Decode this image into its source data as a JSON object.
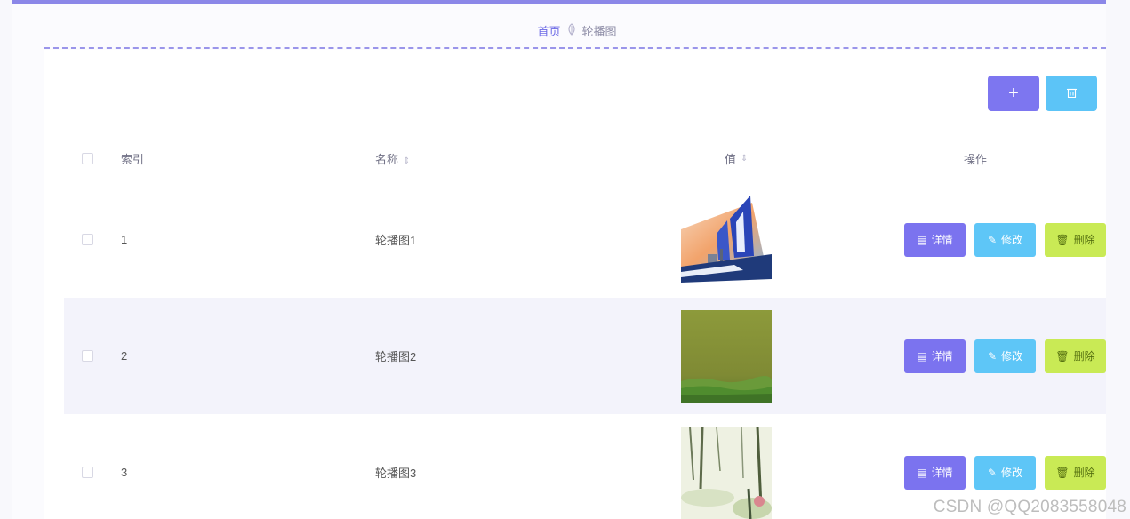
{
  "breadcrumb": {
    "home": "首页",
    "separator_icon": "leaf-icon",
    "current": "轮播图"
  },
  "toolbar": {
    "add_label": "+",
    "batch_delete_icon": "trash-icon"
  },
  "table": {
    "headers": {
      "index": "索引",
      "name": "名称",
      "value": "值",
      "actions": "操作"
    },
    "sort_icon": "sort-icon",
    "rows": [
      {
        "index": "1",
        "name": "轮播图1",
        "image": "sailboats-image"
      },
      {
        "index": "2",
        "name": "轮播图2",
        "image": "grassland-image"
      },
      {
        "index": "3",
        "name": "轮播图3",
        "image": "willow-painting-image"
      }
    ],
    "actions": {
      "detail": "详情",
      "edit": "修改",
      "delete": "删除"
    }
  },
  "watermark": "CSDN @QQ2083558048",
  "colors": {
    "primary": "#7b73ef",
    "info": "#5ec6f7",
    "warning": "#c9ea55",
    "stripe": "#f3f3fb"
  }
}
